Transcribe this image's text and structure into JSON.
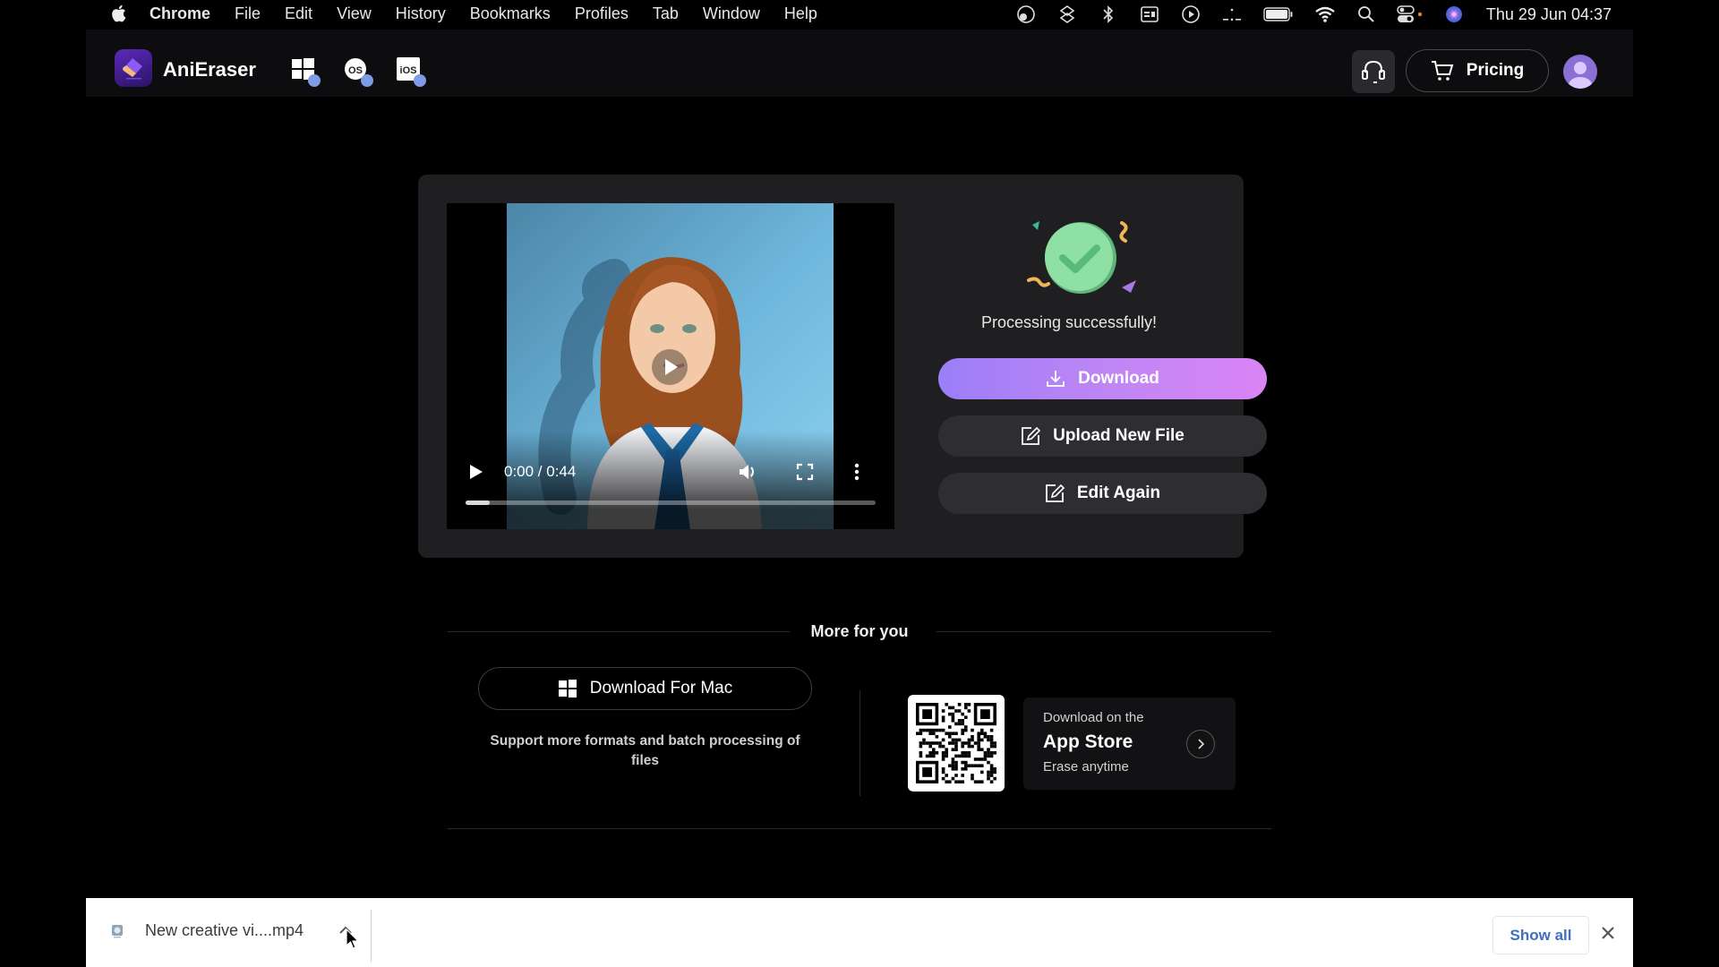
{
  "menubar": {
    "app_name": "Chrome",
    "menus": [
      "File",
      "Edit",
      "View",
      "History",
      "Bookmarks",
      "Profiles",
      "Tab",
      "Window",
      "Help"
    ],
    "status_icons": [
      "cloud-sync-icon",
      "dropbox-icon",
      "bluetooth-icon",
      "calendar-icon",
      "play-circle-icon",
      "dots-icon",
      "battery-icon",
      "wifi-icon",
      "spotlight-search-icon",
      "control-center-icon",
      "siri-icon"
    ],
    "clock": "Thu 29 Jun  04:37"
  },
  "app": {
    "brand": "AniEraser",
    "platforms": [
      "windows",
      "macos",
      "ios"
    ],
    "pricing_label": "Pricing",
    "brand_color": "#5b2bb8"
  },
  "result": {
    "video": {
      "time_display": "0:00 / 0:44",
      "progress_percent": 6
    },
    "status_text": "Processing successfully!",
    "download_label": "Download",
    "upload_label": "Upload New File",
    "edit_label": "Edit Again",
    "accent_gradient": [
      "#9b7ef8",
      "#da84f5"
    ]
  },
  "more": {
    "title": "More for you",
    "download_mac_label": "Download For Mac",
    "download_mac_sub": "Support more formats and batch processing of files",
    "appstore_line1": "Download on the",
    "appstore_line2": "App Store",
    "appstore_line3": "Erase anytime"
  },
  "shelf": {
    "file_name": "New creative vi....mp4",
    "show_all_label": "Show all"
  }
}
